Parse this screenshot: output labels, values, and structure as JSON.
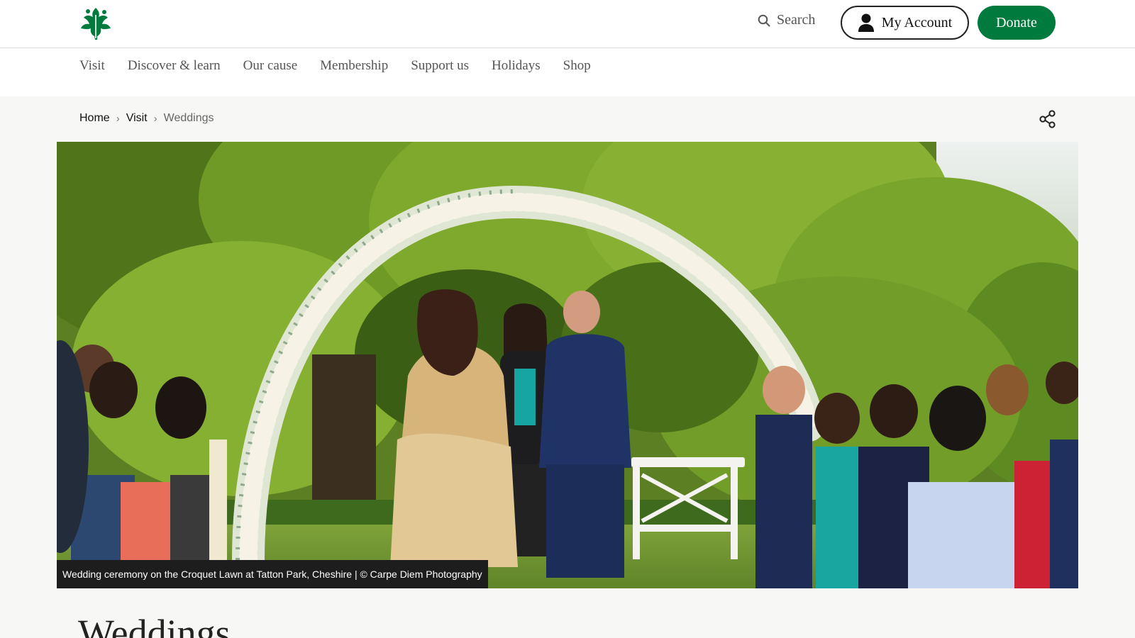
{
  "header": {
    "logo_label": "National Trust oak leaf logo",
    "search_label": "Search",
    "account_label": "My Account",
    "donate_label": "Donate"
  },
  "nav": {
    "items": [
      "Visit",
      "Discover & learn",
      "Our cause",
      "Membership",
      "Support us",
      "Holidays",
      "Shop"
    ]
  },
  "breadcrumb": {
    "items": [
      "Home",
      "Visit",
      "Weddings"
    ]
  },
  "hero": {
    "caption": "Wedding ceremony on the Croquet Lawn at Tatton Park, Cheshire | © Carpe Diem Photography"
  },
  "page": {
    "title": "Weddings"
  },
  "colors": {
    "brand_green": "#007a3d",
    "header_bg": "#ffffff",
    "page_bg": "#f7f7f5",
    "caption_bg": "#1d1d1d"
  },
  "icons": [
    "oak-leaf-logo",
    "search-icon",
    "account-icon",
    "chevron-right-icon",
    "share-icon"
  ]
}
